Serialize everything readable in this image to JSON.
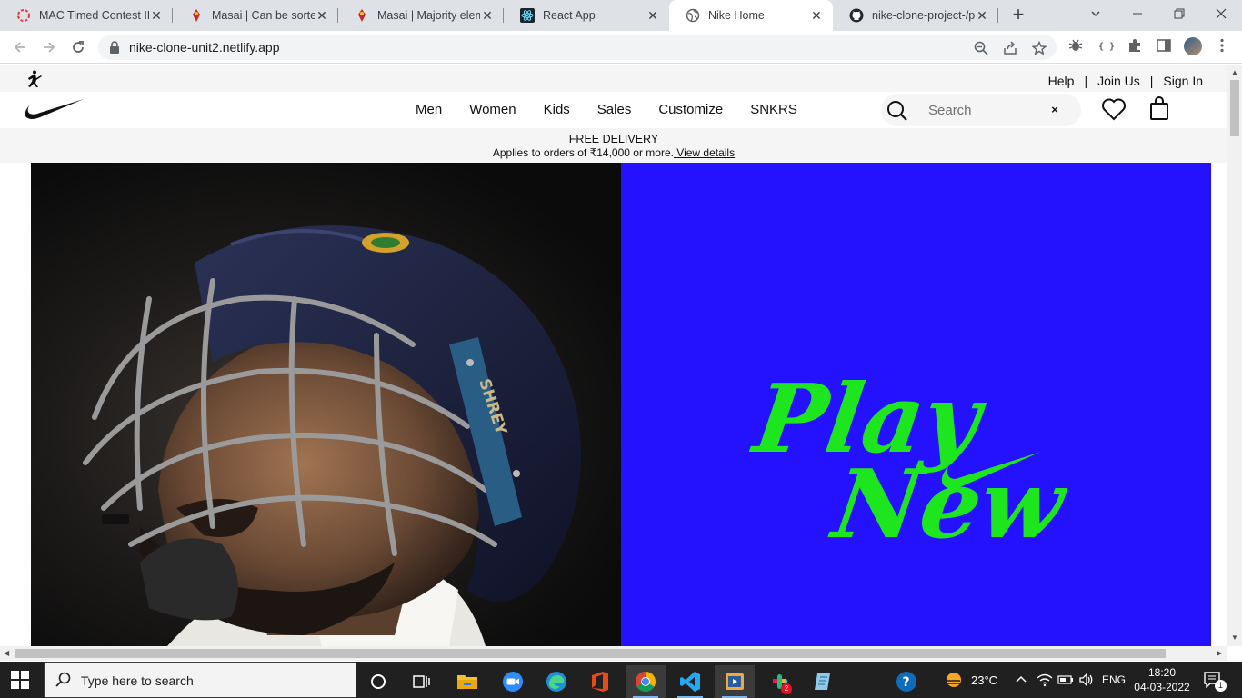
{
  "browser": {
    "tabs": [
      {
        "title": "MAC Timed Contest II",
        "favicon": "masai-icon"
      },
      {
        "title": "Masai | Can be sorted",
        "favicon": "masai-icon"
      },
      {
        "title": "Masai | Majority eleme",
        "favicon": "masai-icon"
      },
      {
        "title": "React App",
        "favicon": "react-icon"
      },
      {
        "title": "Nike Home",
        "favicon": "globe-icon",
        "active": true
      },
      {
        "title": "nike-clone-project-/p",
        "favicon": "github-icon"
      }
    ],
    "close_glyph": "✕",
    "new_tab_glyph": "+",
    "url": "nike-clone-unit2.netlify.app"
  },
  "nike": {
    "top_links": {
      "help": "Help",
      "join": "Join Us",
      "sign_in": "Sign In",
      "separator": "|"
    },
    "nav": [
      "Men",
      "Women",
      "Kids",
      "Sales",
      "Customize",
      "SNKRS"
    ],
    "search": {
      "placeholder": "Search",
      "clear": "×"
    },
    "promo": {
      "title": "FREE DELIVERY",
      "text": "Applies to orders of ₹14,000 or more.",
      "link": " View details"
    },
    "hero": {
      "helmet_text": "SHREY",
      "headline_line1": "Play",
      "headline_line2": "New",
      "brand_color": "#2412ff",
      "headline_color": "#1ee61e"
    }
  },
  "taskbar": {
    "search_placeholder": "Type here to search",
    "weather": "23°C",
    "language": "ENG",
    "time": "18:20",
    "date": "04-03-2022",
    "slack_badge": "2",
    "notification_badge": "1"
  }
}
